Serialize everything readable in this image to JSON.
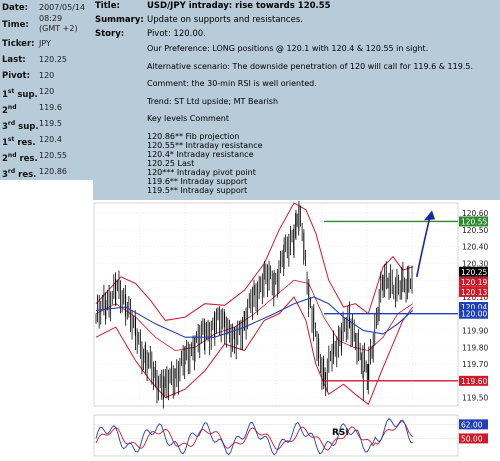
{
  "info": {
    "date_label": "Date:",
    "date_value": "2007/05/14",
    "time_label": "Time:",
    "time_value_1": "08:29",
    "time_value_2": "(GMT +2)",
    "ticker_label": "Ticker:",
    "ticker_value": "JPY",
    "last_label": "Last:",
    "last_value": "120.25",
    "pivot_label": "Pivot:",
    "pivot_value": "120",
    "sup1_num": "1",
    "sup2_num": "2",
    "sup3_num": "3",
    "sup_ord1": "st",
    "sup_ord2": "nd",
    "sup_ord3": "rd",
    "sup_word": "sup.",
    "sup1_value": "120",
    "sup2_value": "119.6",
    "sup3_value": "119.5",
    "res_word": "res.",
    "res1_value": "120.4",
    "res2_value": "120.55",
    "res3_value": "120.86"
  },
  "header": {
    "title_label": "Title:",
    "title_value": "USD/JPY intraday: rise towards 120.55",
    "summary_label": "Summary:",
    "summary_value": "Update on supports and resistances.",
    "story_label": "Story:",
    "story_first": "Pivot: 120.00."
  },
  "story": {
    "preference": "Our Preference: LONG positions @ 120.1 with 120.4 & 120.55 in sight.",
    "alternative": "Alternative scenario: The downside penetration of 120 will call for 119.6 & 119.5.",
    "comment": "Comment: the 30-min RSI is well oriented.",
    "trend": "Trend: ST Ltd upside; MT Bearish",
    "key_levels": "Key levels Comment",
    "levels": [
      "120.86** Fib projection",
      "120.55** Intraday resistance",
      "120.4* Intraday resistance",
      "120.25 Last",
      "120*** Intraday pivot point",
      "119.6** Intraday support",
      "119.5** Intraday support"
    ]
  },
  "chart_data": {
    "type": "line",
    "y_axis_ticks": [
      "120.60",
      "120.50",
      "120.40",
      "120.30",
      "120.20",
      "120.10",
      "120.00",
      "119.90",
      "119.80",
      "119.70",
      "119.60",
      "119.50"
    ],
    "ylim": [
      119.45,
      120.66
    ],
    "price_tags": [
      {
        "value": 120.55,
        "label": "120.55",
        "color": "#2f8a2f"
      },
      {
        "value": 120.25,
        "label": "120.25",
        "color": "#000000"
      },
      {
        "value": 120.19,
        "label": "120.19",
        "color": "#d01a2a"
      },
      {
        "value": 120.13,
        "label": "120.13",
        "color": "#d01a2a"
      },
      {
        "value": 120.04,
        "label": "120.04",
        "color": "#1f3fb8"
      },
      {
        "value": 120.0,
        "label": "120.00",
        "color": "#1f3fb8"
      },
      {
        "value": 119.6,
        "label": "119.60",
        "color": "#d01a2a"
      }
    ],
    "horizontal_levels": [
      {
        "value": 120.55,
        "color": "#2f8a2f"
      },
      {
        "value": 120.0,
        "color": "#1f3fb8"
      },
      {
        "value": 119.6,
        "color": "#d01a2a"
      }
    ],
    "rsi_label": "RSI",
    "rsi_ticks": [
      "62.00",
      "50.00"
    ],
    "rsi_ylim": [
      35,
      70
    ],
    "rsi_value": 62
  }
}
